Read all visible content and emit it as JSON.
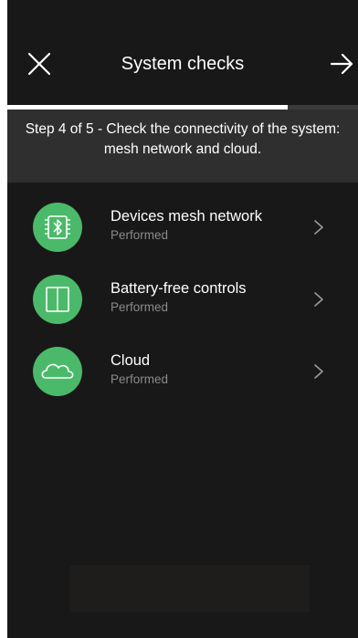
{
  "header": {
    "title": "System checks",
    "close_icon": "close-icon",
    "next_icon": "arrow-right-icon"
  },
  "progress": {
    "current_step": 4,
    "total_steps": 5,
    "fraction": 0.8
  },
  "step_banner": {
    "text": "Step 4 of 5 - Check the connectivity of the system: mesh network and cloud."
  },
  "checks": [
    {
      "title": "Devices mesh network",
      "status": "Performed",
      "icon": "bluetooth-chip-icon"
    },
    {
      "title": "Battery-free controls",
      "status": "Performed",
      "icon": "switch-icon"
    },
    {
      "title": "Cloud",
      "status": "Performed",
      "icon": "cloud-icon"
    }
  ],
  "colors": {
    "background": "#181818",
    "banner": "#2f2f2f",
    "accent_green": "#4bb96a",
    "status_text": "#8a8a8a",
    "progress_fill": "#ffffff"
  }
}
